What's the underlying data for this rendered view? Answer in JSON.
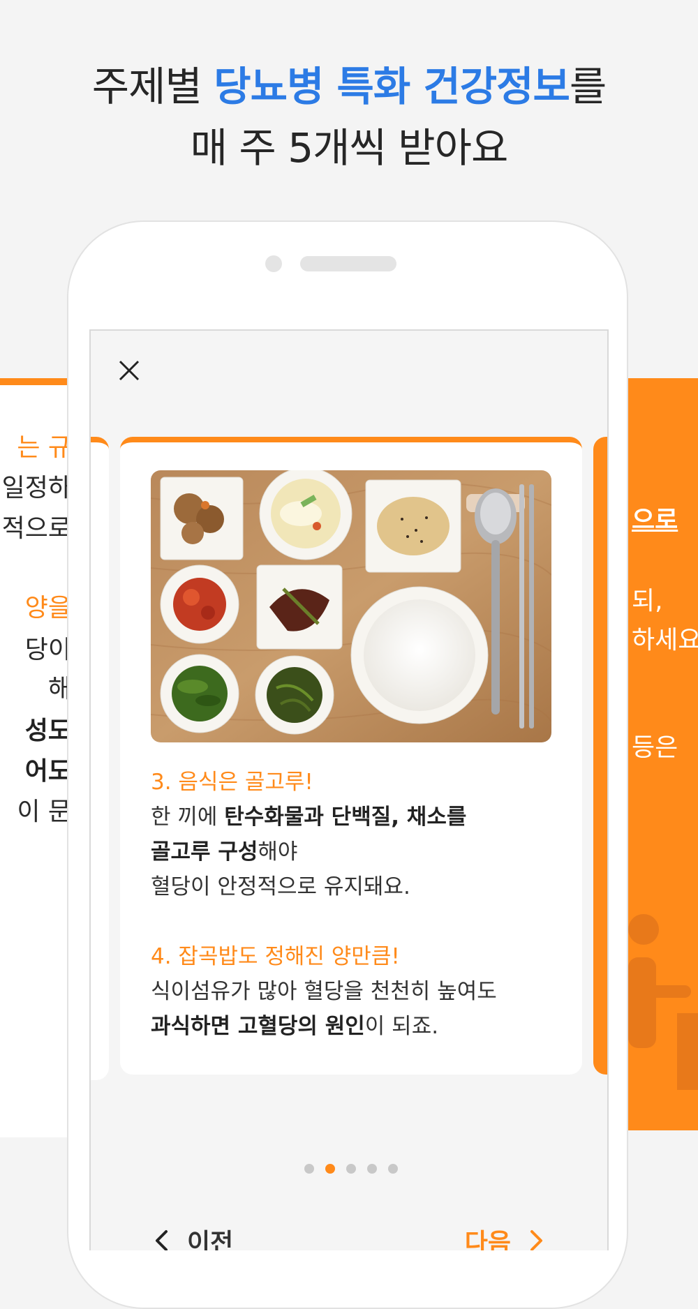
{
  "headline": {
    "line1_pre": "주제별 ",
    "line1_highlight": "당뇨병 특화 건강정보",
    "line1_post": "를",
    "line2": "매 주 5개씩 받아요"
  },
  "left_peek_lines": [
    {
      "text": "는 규",
      "style": "o"
    },
    {
      "text": "일정하",
      "style": ""
    },
    {
      "text": "정적으로",
      "style": ""
    },
    {
      "text": "양을",
      "style": "o"
    },
    {
      "text": "당이 ",
      "style": ""
    },
    {
      "text": "해",
      "style": ""
    },
    {
      "text": "성도 ",
      "style": "b"
    },
    {
      "text": "어도",
      "style": "b"
    },
    {
      "text": "이 문",
      "style": ""
    }
  ],
  "right_peek_lines": [
    {
      "text": "으로",
      "style": "ul"
    },
    {
      "text": "되,",
      "style": ""
    },
    {
      "text": "하세요",
      "style": ""
    },
    {
      "text": "등은",
      "style": ""
    }
  ],
  "card": {
    "image_alt": "food-tray-photo",
    "section3": {
      "title": "3. 음식은 골고루!",
      "l1_pre": "한 끼에 ",
      "l1_bold": "탄수화물과 단백질, 채소를",
      "l2_bold": "골고루 구성",
      "l2_post": "해야",
      "l3": "혈당이 안정적으로 유지돼요."
    },
    "section4": {
      "title": "4. 잡곡밥도 정해진 양만큼!",
      "l1": "식이섬유가 많아 혈당을 천천히 높여도",
      "l2_bold": "과식하면 고혈당의 원인",
      "l2_post": "이 되죠."
    }
  },
  "pager": {
    "total": 5,
    "active_index": 1
  },
  "nav": {
    "prev": "이전",
    "next": "다음"
  },
  "colors": {
    "accent": "#ff8a1a",
    "highlight": "#2c7be5"
  }
}
